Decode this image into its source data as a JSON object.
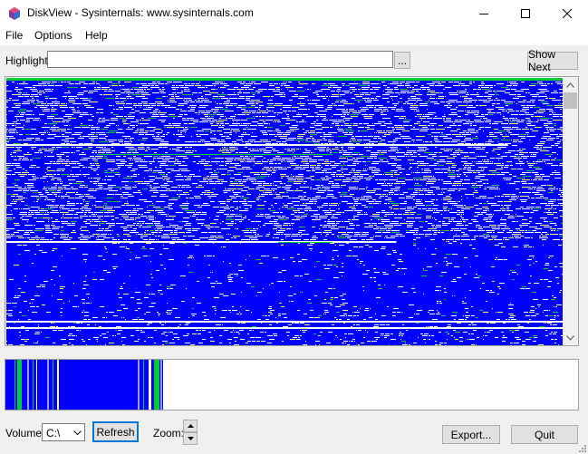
{
  "window": {
    "title": "DiskView - Sysinternals: www.sysinternals.com"
  },
  "menu": [
    "File",
    "Options",
    "Help"
  ],
  "highlight": {
    "label": "Highlight:",
    "value": "",
    "browse_label": "...",
    "show_next_label": "Show Next"
  },
  "footer": {
    "volume_label": "Volume:",
    "volume_value": "C:\\",
    "refresh_label": "Refresh",
    "zoom_label": "Zoom:",
    "export_label": "Export...",
    "quit_label": "Quit"
  },
  "colors": {
    "free_space": "#0000ff",
    "used_file": "#ffffff",
    "fragmented": "#ffff66",
    "system": "#00cc33"
  },
  "icons": [
    "diskview-app-icon",
    "minimize-icon",
    "maximize-icon",
    "close-icon",
    "scroll-up-icon",
    "scroll-down-icon",
    "dropdown-arrow-icon",
    "spin-up-icon",
    "spin-down-icon",
    "size-grip-icon"
  ]
}
